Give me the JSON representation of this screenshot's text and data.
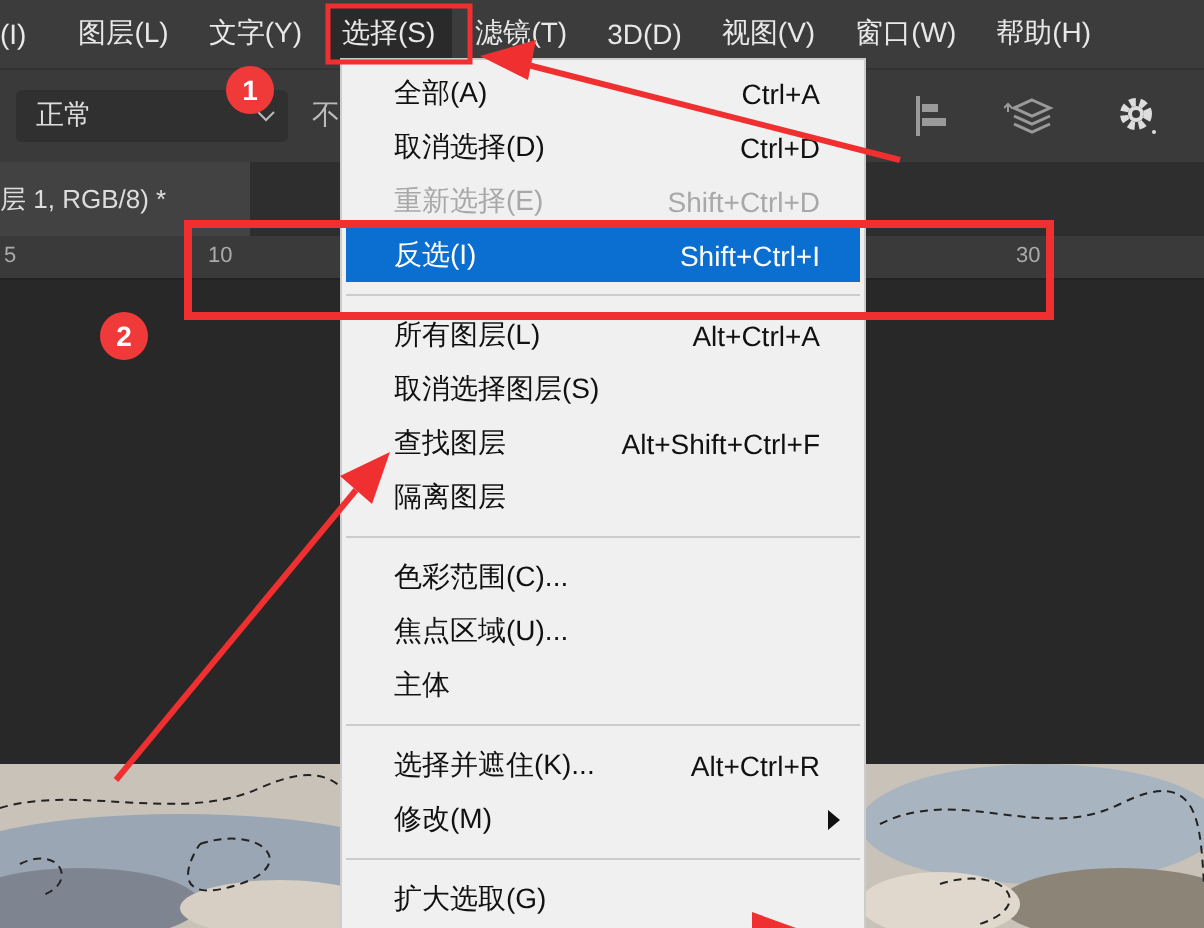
{
  "menu_bar": [
    {
      "label": "(I)",
      "selected": false
    },
    {
      "label": "图层(L)",
      "selected": false
    },
    {
      "label": "文字(Y)",
      "selected": false
    },
    {
      "label": "选择(S)",
      "selected": true
    },
    {
      "label": "滤镜(T)",
      "selected": false
    },
    {
      "label": "3D(D)",
      "selected": false
    },
    {
      "label": "视图(V)",
      "selected": false
    },
    {
      "label": "窗口(W)",
      "selected": false
    },
    {
      "label": "帮助(H)",
      "selected": false
    }
  ],
  "options_bar": {
    "blend_mode": "正常",
    "opacity_label": "不"
  },
  "document_tab": {
    "title": "层 1, RGB/8) *"
  },
  "ruler": {
    "ticks": [
      "5",
      "10",
      "30"
    ]
  },
  "dropdown_menu": {
    "items": [
      {
        "kind": "item",
        "label": "全部(A)",
        "shortcut": "Ctrl+A",
        "disabled": false,
        "selected": false,
        "submenu": false
      },
      {
        "kind": "item",
        "label": "取消选择(D)",
        "shortcut": "Ctrl+D",
        "disabled": false,
        "selected": false,
        "submenu": false
      },
      {
        "kind": "item",
        "label": "重新选择(E)",
        "shortcut": "Shift+Ctrl+D",
        "disabled": true,
        "selected": false,
        "submenu": false
      },
      {
        "kind": "item",
        "label": "反选(I)",
        "shortcut": "Shift+Ctrl+I",
        "disabled": false,
        "selected": true,
        "submenu": false
      },
      {
        "kind": "separator"
      },
      {
        "kind": "item",
        "label": "所有图层(L)",
        "shortcut": "Alt+Ctrl+A",
        "disabled": false,
        "selected": false,
        "submenu": false
      },
      {
        "kind": "item",
        "label": "取消选择图层(S)",
        "disabled": false,
        "selected": false,
        "submenu": false
      },
      {
        "kind": "item",
        "label": "查找图层",
        "shortcut": "Alt+Shift+Ctrl+F",
        "disabled": false,
        "selected": false,
        "submenu": false
      },
      {
        "kind": "item",
        "label": "隔离图层",
        "disabled": false,
        "selected": false,
        "submenu": false
      },
      {
        "kind": "separator"
      },
      {
        "kind": "item",
        "label": "色彩范围(C)...",
        "disabled": false,
        "selected": false,
        "submenu": false
      },
      {
        "kind": "item",
        "label": "焦点区域(U)...",
        "disabled": false,
        "selected": false,
        "submenu": false
      },
      {
        "kind": "item",
        "label": "主体",
        "disabled": false,
        "selected": false,
        "submenu": false
      },
      {
        "kind": "separator"
      },
      {
        "kind": "item",
        "label": "选择并遮住(K)...",
        "shortcut": "Alt+Ctrl+R",
        "disabled": false,
        "selected": false,
        "submenu": false
      },
      {
        "kind": "item",
        "label": "修改(M)",
        "disabled": false,
        "selected": false,
        "submenu": true
      },
      {
        "kind": "separator"
      },
      {
        "kind": "item",
        "label": "扩大选取(G)",
        "disabled": false,
        "selected": false,
        "submenu": false
      }
    ]
  },
  "annotations": {
    "markers": [
      "1",
      "2"
    ]
  }
}
